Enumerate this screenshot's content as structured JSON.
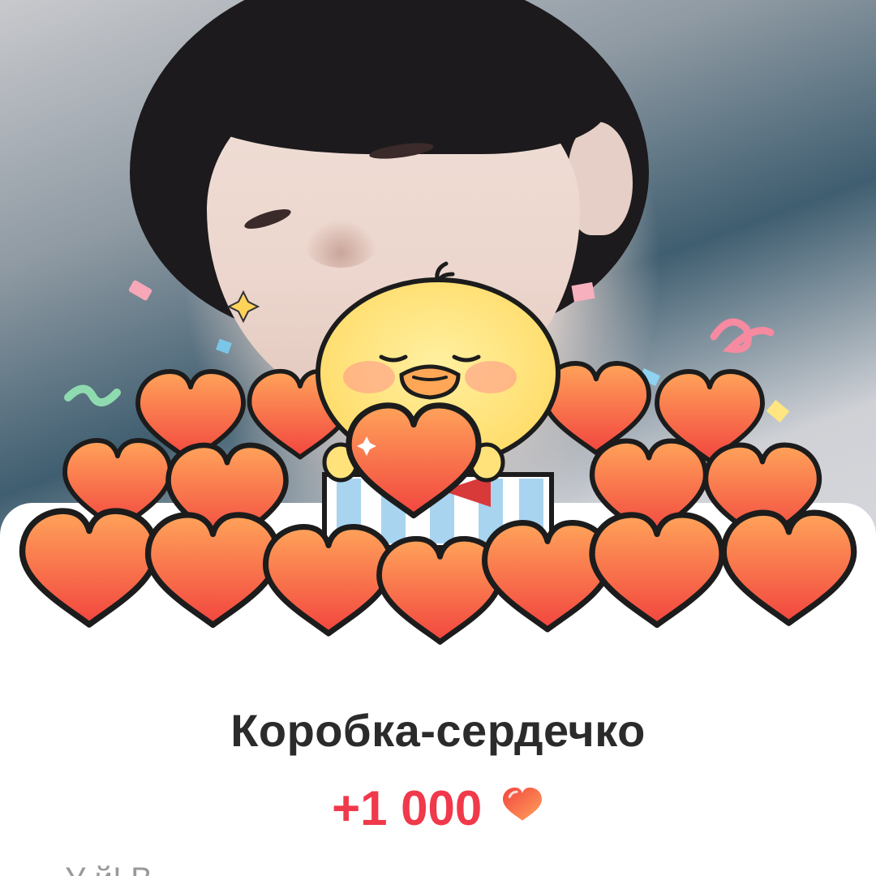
{
  "gift": {
    "title": "Коробка-сердечко",
    "reward_amount": "+1 000",
    "reward_icon": "heart-icon",
    "description_partial": "У         й! В"
  },
  "colors": {
    "accent_red": "#f0394a",
    "title_text": "#2b2b2b",
    "heart_fill_top": "#ff9a55",
    "heart_fill_bottom": "#f2453f",
    "chick_yellow": "#ffe27a"
  }
}
